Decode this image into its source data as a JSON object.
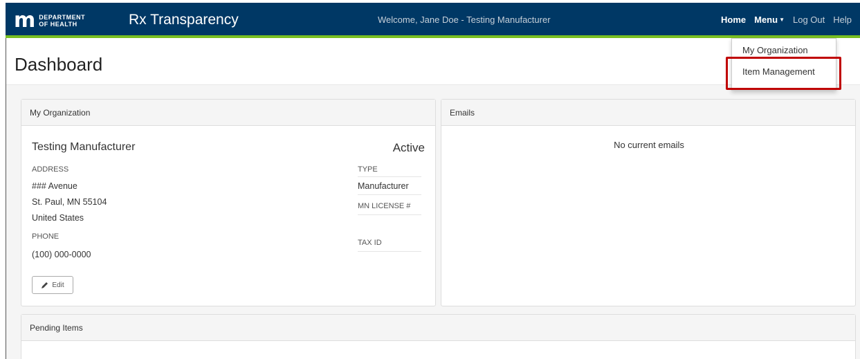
{
  "header": {
    "logo_mark": "m",
    "logo_line1": "DEPARTMENT",
    "logo_line2": "OF HEALTH",
    "brand": "Rx Transparency",
    "welcome": "Welcome, Jane Doe - Testing Manufacturer",
    "nav": {
      "home": "Home",
      "menu": "Menu",
      "logout": "Log Out",
      "help": "Help"
    }
  },
  "dropdown": {
    "items": [
      "My Organization",
      "Item Management"
    ]
  },
  "page": {
    "title": "Dashboard"
  },
  "org_panel": {
    "heading": "My Organization",
    "name": "Testing Manufacturer",
    "status": "Active",
    "address_label": "ADDRESS",
    "address_line1": "### Avenue",
    "address_line2": "St. Paul, MN 55104",
    "address_line3": "United States",
    "phone_label": "PHONE",
    "phone": "(100) 000-0000",
    "type_label": "TYPE",
    "type": "Manufacturer",
    "license_label": "MN LICENSE #",
    "tax_label": "TAX ID",
    "edit_label": "Edit"
  },
  "email_panel": {
    "heading": "Emails",
    "empty": "No current emails"
  },
  "pending_panel": {
    "heading": "Pending Items"
  },
  "colors": {
    "navbar": "#003865",
    "accent_green": "#78be21",
    "highlight_red": "#c00000"
  }
}
